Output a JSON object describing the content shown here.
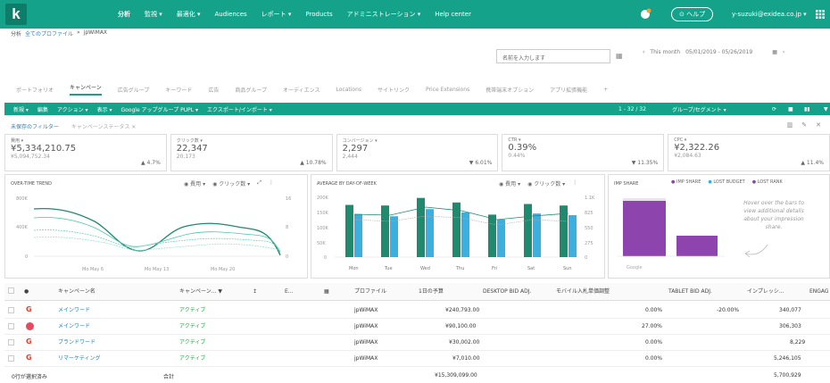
{
  "topnav": {
    "logo": "k",
    "items": [
      "分析",
      "監視 ▾",
      "最適化 ▾",
      "Audiences",
      "レポート ▾",
      "Products",
      "アドミニストレーション ▾",
      "Help center"
    ],
    "help": "ヘルプ",
    "user": "y-suzuki@exidea.co.jp ▾"
  },
  "breadcrumb": [
    "分析",
    "全てのプロファイル",
    "»",
    "jpWiMAX"
  ],
  "search": {
    "placeholder": "名前を入力します"
  },
  "daterange": {
    "prefix": "This month",
    "value": "05/01/2019 - 05/26/2019"
  },
  "tabs": [
    "ポートフォリオ",
    "キャンペーン",
    "広告グループ",
    "キーワード",
    "広告",
    "商品グループ",
    "オーディエンス",
    "Locations",
    "サイトリンク",
    "Price Extensions",
    "携帯端末オプション",
    "アプリ拡張機能",
    "+"
  ],
  "toolbar": {
    "items": [
      "新規 ▾",
      "編集",
      "アクション ▾",
      "表示 ▾",
      "Google アップグループ PUPL ▾",
      "エクスポート/インポート ▾"
    ],
    "pagination": "1 - 32 / 32",
    "segment": "グループ/セグメント ▾"
  },
  "filters": {
    "filter": "未保存のフィルター",
    "status": "キャンペーンステータス ✕"
  },
  "metrics": [
    {
      "label": "費用 ▾",
      "value": "¥5,334,210.75",
      "prev": "¥5,094,752.34",
      "change": "▲ 4.7%"
    },
    {
      "label": "クリック数 ▾",
      "value": "22,347",
      "prev": "20,173",
      "change": "▲ 10.78%"
    },
    {
      "label": "コンバージョン ▾",
      "value": "2,297",
      "prev": "2,444",
      "change": "▼ 6.01%"
    },
    {
      "label": "CTR ▾",
      "value": "0.39%",
      "prev": "0.44%",
      "change": "▼ 11.35%"
    },
    {
      "label": "CPC ▾",
      "value": "¥2,322.26",
      "prev": "¥2,084.63",
      "change": "▲ 11.4%"
    }
  ],
  "trend": {
    "title": "OVER-TIME TREND",
    "legend": [
      "費用",
      "クリック数"
    ],
    "yleft": [
      "800K",
      "400K",
      "0"
    ],
    "yright": [
      "16",
      "8",
      "0"
    ],
    "x": [
      "Mo May 6",
      "Mo May 13",
      "Mo May 20"
    ]
  },
  "dow": {
    "title": "AVERAGE BY DAY-OF-WEEK",
    "legend": [
      "費用",
      "クリック数"
    ],
    "yleft": [
      "200K",
      "150K",
      "100K",
      "50K",
      "0"
    ],
    "yright": [
      "1.1K",
      "825",
      "550",
      "275",
      "0"
    ],
    "x": [
      "Mon",
      "Tue",
      "Wed",
      "Thu",
      "Fri",
      "Sat",
      "Sun"
    ]
  },
  "imp": {
    "title": "IMP SHARE",
    "legend": [
      "IMP SHARE",
      "LOST BUDGET",
      "LOST RANK"
    ],
    "hint": "Hover over the bars to view additional details about your impression share.",
    "x": [
      "Google"
    ]
  },
  "chart_data": [
    {
      "type": "line",
      "title": "OVER-TIME TREND",
      "x": [
        "Mo May 6",
        "Mo May 13",
        "Mo May 20"
      ],
      "series": [
        {
          "name": "費用",
          "values": [
            500,
            230,
            330
          ]
        },
        {
          "name": "クリック数",
          "values": [
            8,
            5,
            6
          ]
        }
      ]
    },
    {
      "type": "bar",
      "title": "AVERAGE BY DAY-OF-WEEK",
      "categories": [
        "Mon",
        "Tue",
        "Wed",
        "Thu",
        "Fri",
        "Sat",
        "Sun"
      ],
      "series": [
        {
          "name": "費用",
          "values": [
            172,
            170,
            195,
            180,
            140,
            175,
            170
          ]
        },
        {
          "name": "クリック数",
          "values": [
            780,
            740,
            870,
            810,
            680,
            790,
            760
          ]
        }
      ],
      "ylim": [
        0,
        200
      ]
    },
    {
      "type": "bar",
      "title": "IMP SHARE",
      "categories": [
        "Google",
        ""
      ],
      "series": [
        {
          "name": "IMP SHARE",
          "values": [
            0.78,
            0.29
          ]
        }
      ],
      "ylim": [
        0,
        1
      ]
    }
  ],
  "table": {
    "headers": [
      "キャンペーン名",
      "キャンペーン... ▼",
      "E...",
      "プロファイル",
      "1日の予算",
      "DESKTOP BID ADJ.",
      "モバイル入札単価調整",
      "TABLET BID ADJ.",
      "インプレッシ...",
      "ENGAG"
    ],
    "rows": [
      {
        "name": "メインワード",
        "status": "アクティブ",
        "profile": "jpWiMAX",
        "budget": "¥240,793.00",
        "mobile": "0.00%",
        "tablet": "-20.00%",
        "imp": "340,077",
        "icon": "g"
      },
      {
        "name": "メインワード",
        "status": "アクティブ",
        "profile": "jpWiMAX",
        "budget": "¥90,100.00",
        "mobile": "27.00%",
        "tablet": "",
        "imp": "306,303",
        "icon": "p"
      },
      {
        "name": "ブランドワード",
        "status": "アクティブ",
        "profile": "jpWiMAX",
        "budget": "¥30,002.00",
        "mobile": "0.00%",
        "tablet": "",
        "imp": "8,229",
        "icon": "g"
      },
      {
        "name": "リマーケティング",
        "status": "アクティブ",
        "profile": "jpWiMAX",
        "budget": "¥7,010.00",
        "mobile": "0.00%",
        "tablet": "",
        "imp": "5,246,105",
        "icon": "g"
      }
    ],
    "footer": {
      "label": "0行が選択済み",
      "total_label": "合計",
      "budget_total": "¥15,309,099.00",
      "imp_total": "5,700,929"
    }
  }
}
